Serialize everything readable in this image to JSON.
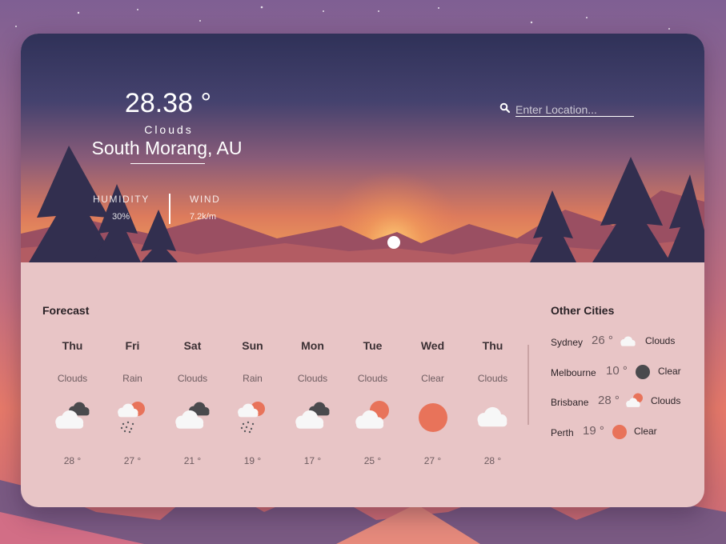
{
  "current": {
    "temperature": "28.38 °",
    "condition": "Clouds",
    "location": "South Morang, AU",
    "humidity_label": "HUMIDITY",
    "humidity_value": "30%",
    "wind_label": "WIND",
    "wind_value": "7.2k/m"
  },
  "search": {
    "placeholder": "Enter Location..."
  },
  "forecast": {
    "title": "Forecast",
    "days": [
      {
        "day": "Thu",
        "condition": "Clouds",
        "icon": "dark-clouds-icon",
        "temp": "28 °"
      },
      {
        "day": "Fri",
        "condition": "Rain",
        "icon": "sun-rain-icon",
        "temp": "27 °"
      },
      {
        "day": "Sat",
        "condition": "Clouds",
        "icon": "dark-clouds-icon",
        "temp": "21 °"
      },
      {
        "day": "Sun",
        "condition": "Rain",
        "icon": "sun-rain-icon",
        "temp": "19 °"
      },
      {
        "day": "Mon",
        "condition": "Clouds",
        "icon": "dark-clouds-icon",
        "temp": "17 °"
      },
      {
        "day": "Tue",
        "condition": "Clouds",
        "icon": "sun-cloud-icon",
        "temp": "25 °"
      },
      {
        "day": "Wed",
        "condition": "Clear",
        "icon": "sun-icon",
        "temp": "27 °"
      },
      {
        "day": "Thu",
        "condition": "Clouds",
        "icon": "cloud-icon",
        "temp": "28 °"
      }
    ]
  },
  "other_cities": {
    "title": "Other Cities",
    "cities": [
      {
        "name": "Sydney",
        "temp": "26 °",
        "icon": "cloud-icon",
        "condition": "Clouds"
      },
      {
        "name": "Melbourne",
        "temp": "10 °",
        "icon": "dark-moon-icon",
        "condition": "Clear"
      },
      {
        "name": "Brisbane",
        "temp": "28 °",
        "icon": "sun-cloud-icon",
        "condition": "Clouds"
      },
      {
        "name": "Perth",
        "temp": "19 °",
        "icon": "sun-icon",
        "condition": "Clear"
      }
    ]
  },
  "colors": {
    "sun": "#e8735a",
    "cloud": "#f7f7f7",
    "dark_cloud": "#4a4a4d",
    "panel": "#e8c5c6"
  }
}
